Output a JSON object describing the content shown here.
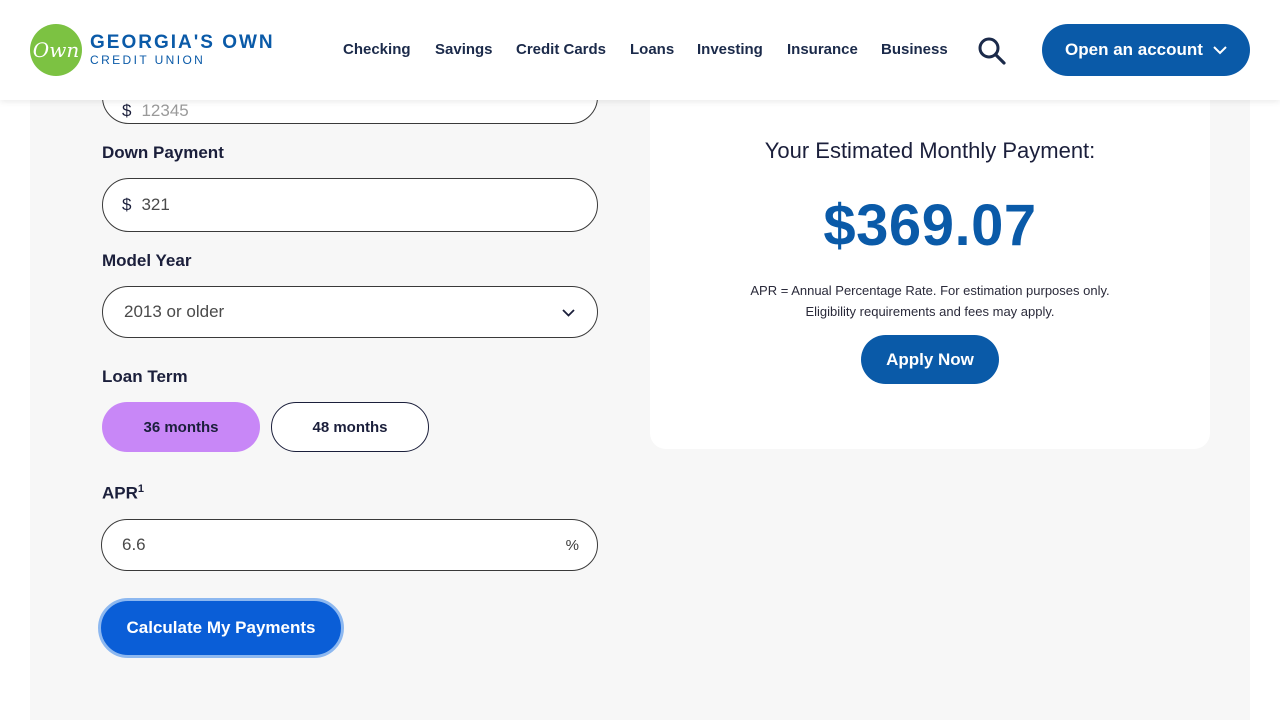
{
  "brand": {
    "logo_mark": "Own",
    "name_line1": "GEORGIA'S OWN",
    "name_line2": "CREDIT UNION",
    "green": "#7cc242",
    "blue": "#0a5aa8"
  },
  "nav": {
    "items": [
      {
        "label": "Checking"
      },
      {
        "label": "Savings"
      },
      {
        "label": "Credit Cards"
      },
      {
        "label": "Loans"
      },
      {
        "label": "Investing"
      },
      {
        "label": "Insurance"
      },
      {
        "label": "Business"
      }
    ],
    "search_icon": "search-icon",
    "cta_label": "Open an account"
  },
  "form": {
    "loan_amount": {
      "prefix": "$",
      "value": "12345"
    },
    "down_payment": {
      "label": "Down Payment",
      "prefix": "$",
      "value": "321"
    },
    "model_year": {
      "label": "Model Year",
      "selected": "2013 or older"
    },
    "loan_term": {
      "label": "Loan Term",
      "options": [
        {
          "label": "36 months",
          "selected": true
        },
        {
          "label": "48 months",
          "selected": false
        }
      ],
      "active_color": "#c887f7"
    },
    "apr": {
      "label": "APR",
      "footnote": "1",
      "value": "6.6",
      "unit": "%"
    },
    "calculate_label": "Calculate My Payments"
  },
  "result": {
    "title": "Your Estimated Monthly Payment:",
    "amount": "$369.07",
    "disclaimer_line1": "APR = Annual Percentage Rate. For estimation purposes only.",
    "disclaimer_line2": "Eligibility requirements and fees may apply.",
    "apply_label": "Apply Now"
  }
}
